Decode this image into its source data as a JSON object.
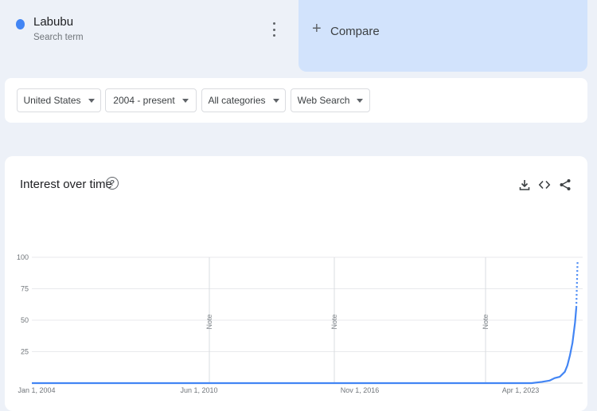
{
  "search_term": {
    "title": "Labubu",
    "subtitle": "Search term",
    "color": "#4285f4"
  },
  "compare": {
    "label": "Compare"
  },
  "filters": {
    "region": "United States",
    "time_range": "2004 - present",
    "category": "All categories",
    "search_type": "Web Search"
  },
  "interest_over_time": {
    "title": "Interest over time",
    "icons": [
      "help-icon",
      "download-icon",
      "embed-icon",
      "share-icon"
    ]
  },
  "chart_data": {
    "type": "line",
    "title": "Interest over time",
    "xlabel": "",
    "ylabel": "",
    "ylim": [
      0,
      100
    ],
    "yticks": [
      25,
      50,
      75,
      100
    ],
    "x_tick_labels": [
      "Jan 1, 2004",
      "Jun 1, 2010",
      "Nov 1, 2016",
      "Apr 1, 2023"
    ],
    "xlim": [
      2004.0,
      2025.6
    ],
    "notes": [
      {
        "x": 2011.7,
        "label": "Note"
      },
      {
        "x": 2017.0,
        "label": "Note"
      },
      {
        "x": 2023.3,
        "label": "Note"
      }
    ],
    "series": [
      {
        "color": "#4285f4",
        "x": [
          2004.0,
          2022.0,
          2023.6,
          2024.0,
          2024.3,
          2024.5,
          2024.7,
          2024.9,
          2025.0,
          2025.1,
          2025.2,
          2025.3,
          2025.35
        ],
        "y": [
          0,
          0,
          0,
          1,
          2,
          4,
          5,
          9,
          14,
          22,
          32,
          48,
          60
        ],
        "partial": {
          "x": [
            2025.35,
            2025.4
          ],
          "y": [
            60,
            97
          ]
        }
      }
    ],
    "grid": true
  }
}
